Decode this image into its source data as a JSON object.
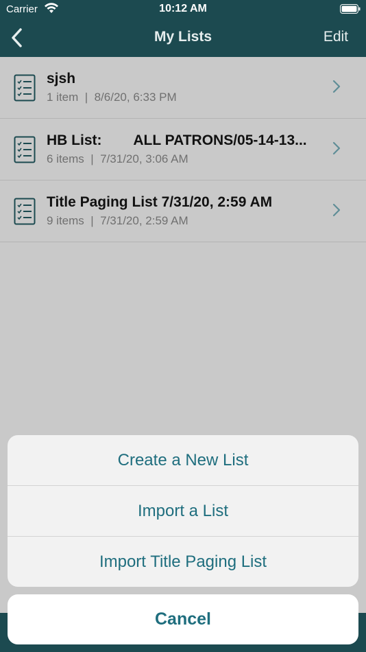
{
  "status_bar": {
    "carrier": "Carrier",
    "time": "10:12 AM"
  },
  "nav": {
    "title": "My Lists",
    "edit_label": "Edit",
    "icons": {
      "back": "chevron-left-icon"
    }
  },
  "lists": [
    {
      "title": "sjsh",
      "subtitle": "1 item  |  8/6/20, 6:33 PM"
    },
    {
      "title": "HB List:        ALL PATRONS/05-14-13...",
      "subtitle": "6 items  |  7/31/20, 3:06 AM"
    },
    {
      "title": "Title Paging List 7/31/20, 2:59 AM",
      "subtitle": "9 items  |  7/31/20, 2:59 AM"
    }
  ],
  "action_sheet": {
    "actions": [
      {
        "label": "Create a New List"
      },
      {
        "label": "Import a List"
      },
      {
        "label": "Import Title Paging List"
      }
    ],
    "cancel_label": "Cancel"
  },
  "colors": {
    "nav_bg": "#1c4a50",
    "accent": "#1f6e7e",
    "dimmed_bg": "#c9c9c9",
    "sheet_bg": "#f2f2f2"
  }
}
